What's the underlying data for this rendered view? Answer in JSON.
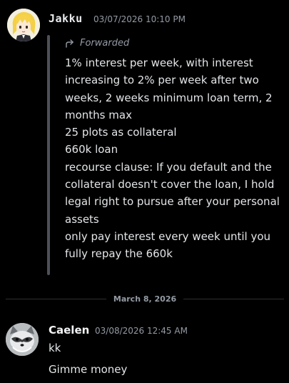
{
  "messages": [
    {
      "author": "Jakku",
      "timestamp": "03/07/2026 10:10 PM",
      "forwarded": {
        "label": "Forwarded",
        "text": "1% interest per week, with interest increasing to 2% per week after two weeks, 2 weeks minimum loan term, 2 months max\n25 plots as collateral\n660k loan\nrecourse clause: If you default and the collateral doesn't cover the loan, I hold legal right to pursue after your personal assets\nonly pay interest every week until you fully repay the 660k"
      },
      "avatar_icon": "anime-girl-avatar"
    },
    {
      "author": "Caelen",
      "timestamp": "03/08/2026 12:45 AM",
      "lines": [
        "kk",
        "Gimme money"
      ],
      "avatar_icon": "raccoon-avatar"
    }
  ],
  "divider": {
    "date": "March 8, 2026"
  },
  "colors": {
    "background": "#000000",
    "text": "#e3e5e8",
    "muted": "#949ba4",
    "forward_bar": "#4e5058"
  }
}
